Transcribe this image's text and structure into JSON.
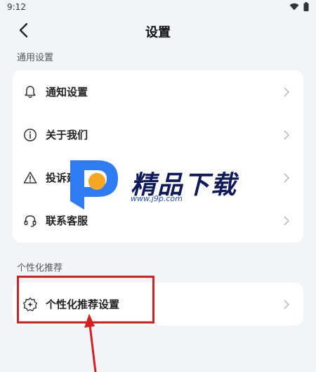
{
  "status": {
    "time": "9:12"
  },
  "header": {
    "title": "设置"
  },
  "sections": {
    "general": {
      "label": "通用设置",
      "items": [
        {
          "label": "通知设置",
          "icon": "bell-icon"
        },
        {
          "label": "关于我们",
          "icon": "info-icon"
        },
        {
          "label": "投诉建议",
          "icon": "warning-icon"
        },
        {
          "label": "联系客服",
          "icon": "headset-icon"
        }
      ]
    },
    "personalized": {
      "label": "个性化推荐",
      "items": [
        {
          "label": "个性化推荐设置",
          "icon": "sparkle-badge-icon"
        }
      ]
    }
  },
  "watermark": {
    "title": "精品下载",
    "url": "www.j9p.com"
  },
  "colors": {
    "background": "#f3f4f8",
    "card": "#ffffff",
    "annotation": "#d42020",
    "watermark_blue": "#1f6ff0",
    "watermark_orange": "#f5a623"
  }
}
